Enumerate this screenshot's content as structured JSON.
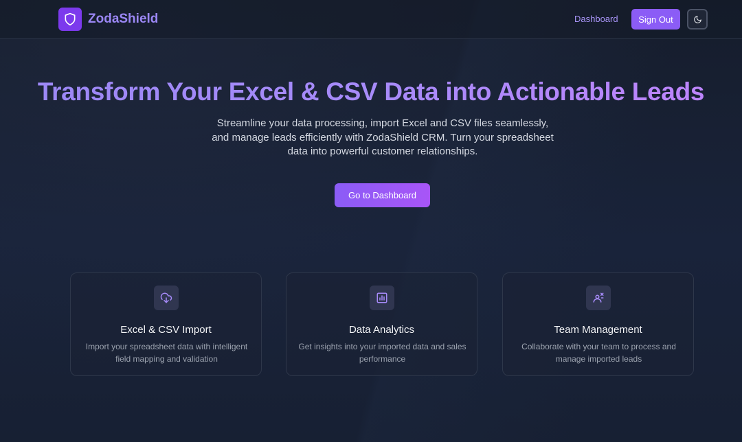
{
  "header": {
    "brand": "ZodaShield",
    "logo_icon": "shield-icon",
    "nav_dashboard": "Dashboard",
    "sign_out": "Sign Out",
    "theme_icon": "moon-icon"
  },
  "hero": {
    "title": "Transform Your Excel & CSV Data into Actionable Leads",
    "subtitle": "Streamline your data processing, import Excel and CSV files seamlessly, and manage leads efficiently with ZodaShield CRM. Turn your spreadsheet data into powerful customer relationships.",
    "cta": "Go to Dashboard"
  },
  "features": [
    {
      "icon": "cloud-download-icon",
      "title": "Excel & CSV Import",
      "description": "Import your spreadsheet data with intelligent field mapping and validation"
    },
    {
      "icon": "bar-chart-icon",
      "title": "Data Analytics",
      "description": "Get insights into your imported data and sales performance"
    },
    {
      "icon": "team-icon",
      "title": "Team Management",
      "description": "Collaborate with your team to process and manage imported leads"
    }
  ],
  "colors": {
    "accent": "#8b5cf6",
    "brand_text": "#9b87f5",
    "background": "#161d2c"
  }
}
